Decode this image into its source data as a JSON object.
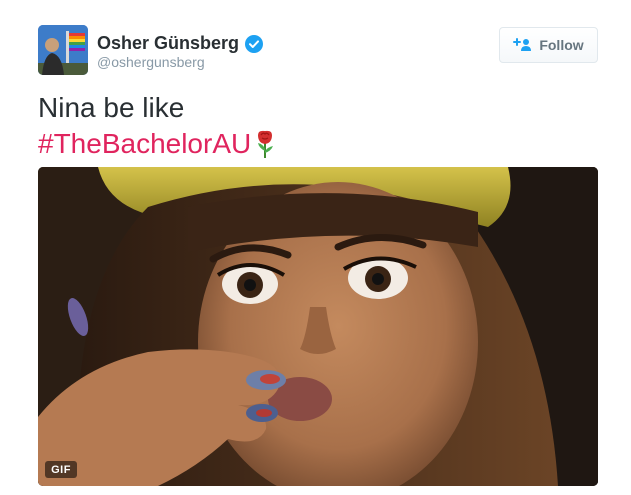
{
  "author": {
    "name": "Osher Günsberg",
    "handle": "@oshergunsberg",
    "verified": true,
    "avatar_icon": "profile-photo"
  },
  "follow_button": {
    "label": "Follow",
    "icon": "add-user-icon"
  },
  "tweet": {
    "text_line": "Nina be like",
    "hashtag": "#TheBachelorAU",
    "emoji_icon": "rose-icon"
  },
  "media": {
    "badge": "GIF"
  },
  "colors": {
    "hashtag": "#e0245e",
    "verified": "#1da1f2",
    "handle": "#8899a6",
    "text": "#292f33"
  }
}
